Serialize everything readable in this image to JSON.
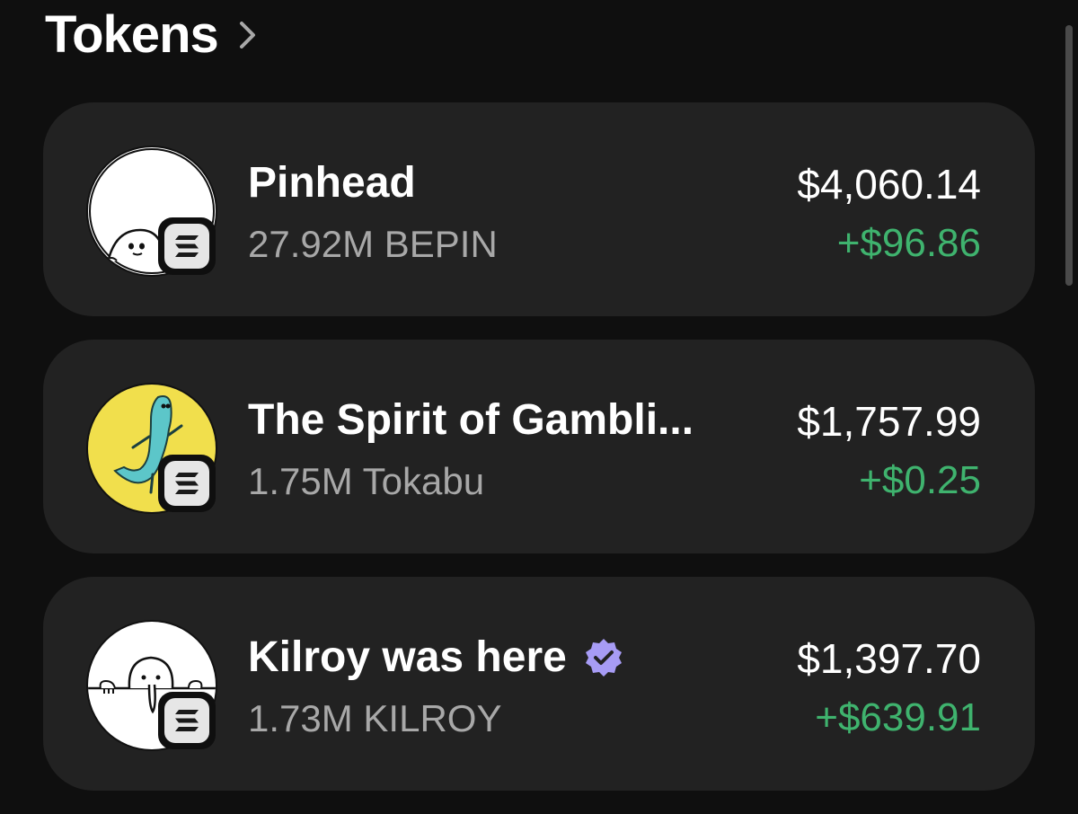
{
  "header": {
    "title": "Tokens",
    "chevron_icon": "chevron-right-icon"
  },
  "colors": {
    "background": "#0f0f0f",
    "card": "#222222",
    "secondary_text": "#a8a8a8",
    "positive": "#3fb36e",
    "verified": "#a79cf5"
  },
  "tokens": [
    {
      "name": "Pinhead",
      "amount": "27.92M BEPIN",
      "value": "$4,060.14",
      "change": "+$96.86",
      "verified": false,
      "avatar_icon": "pinhead-logo",
      "chain_icon": "solana-icon"
    },
    {
      "name": "The Spirit of Gambli...",
      "amount": "1.75M Tokabu",
      "value": "$1,757.99",
      "change": "+$0.25",
      "verified": false,
      "avatar_icon": "tokabu-logo",
      "chain_icon": "solana-icon"
    },
    {
      "name": "Kilroy was here",
      "amount": "1.73M KILROY",
      "value": "$1,397.70",
      "change": "+$639.91",
      "verified": true,
      "avatar_icon": "kilroy-logo",
      "chain_icon": "solana-icon"
    }
  ]
}
